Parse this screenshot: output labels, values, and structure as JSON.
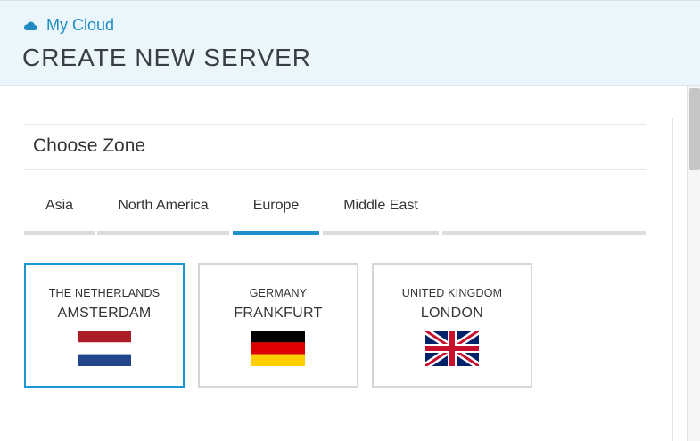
{
  "header": {
    "breadcrumb": "My Cloud",
    "title": "CREATE NEW SERVER",
    "brand_color": "#1f8ac4"
  },
  "section": {
    "title": "Choose Zone"
  },
  "tabs": [
    {
      "label": "Asia",
      "active": false
    },
    {
      "label": "North America",
      "active": false
    },
    {
      "label": "Europe",
      "active": true
    },
    {
      "label": "Middle East",
      "active": false
    }
  ],
  "zones": [
    {
      "country": "THE NETHERLANDS",
      "city": "AMSTERDAM",
      "flag_icon": "netherlands-flag-icon",
      "selected": true
    },
    {
      "country": "GERMANY",
      "city": "FRANKFURT",
      "flag_icon": "germany-flag-icon",
      "selected": false
    },
    {
      "country": "UNITED KINGDOM",
      "city": "LONDON",
      "flag_icon": "uk-flag-icon",
      "selected": false
    }
  ],
  "colors": {
    "accent": "#1e8fcc",
    "header_bg": "#eaf6fb"
  }
}
